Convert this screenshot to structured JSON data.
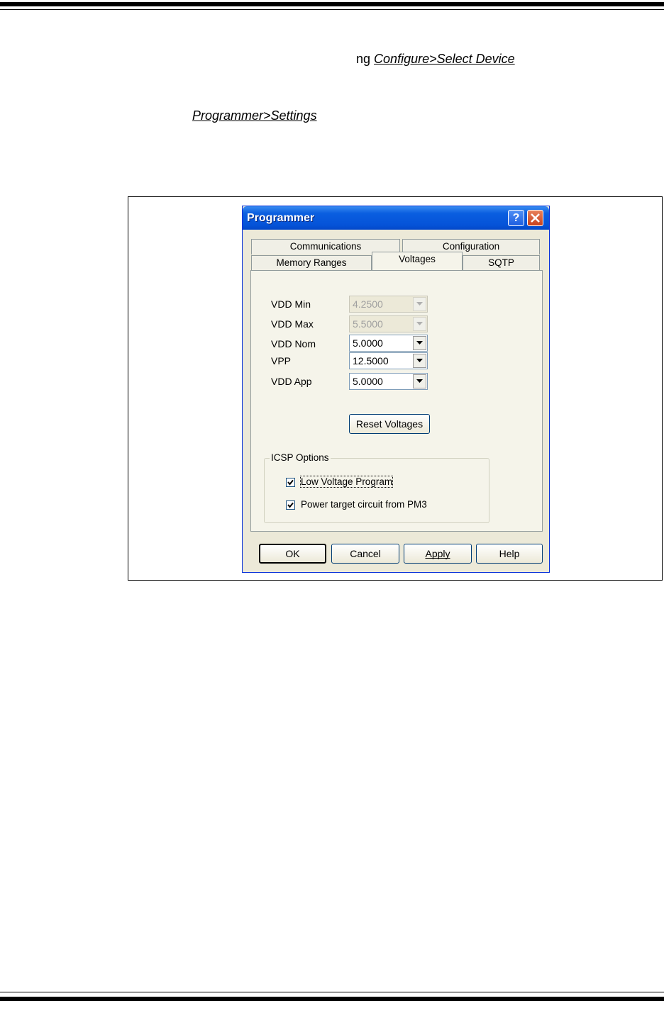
{
  "document": {
    "line1_prefix": "ng",
    "line1_link": "Configure>Select Device",
    "line2_link": "Programmer>Settings"
  },
  "dialog": {
    "title": "Programmer",
    "help_button": "?",
    "tabs_back_row": [
      "Communications",
      "Configuration"
    ],
    "tabs_front_row": [
      "Memory Ranges",
      "Voltages",
      "SQTP"
    ],
    "active_tab": "Voltages",
    "fields": [
      {
        "label": "VDD Min",
        "value": "4.2500",
        "enabled": false
      },
      {
        "label": "VDD Max",
        "value": "5.5000",
        "enabled": false
      },
      {
        "label": "VDD Nom",
        "value": "5.0000",
        "enabled": true
      },
      {
        "label": "VPP",
        "value": "12.5000",
        "enabled": true
      },
      {
        "label": "VDD App",
        "value": "5.0000",
        "enabled": true
      }
    ],
    "reset_button": "Reset Voltages",
    "icsp_group": {
      "title": "ICSP Options",
      "options": [
        {
          "label": "Low Voltage Program",
          "checked": true
        },
        {
          "label": "Power target circuit from PM3",
          "checked": true
        }
      ]
    },
    "footer_buttons": [
      "OK",
      "Cancel",
      "Apply",
      "Help"
    ]
  },
  "colors": {
    "titlebar": "#0553d8",
    "dialog_bg": "#ece9d8",
    "close_button": "#c8401c"
  }
}
